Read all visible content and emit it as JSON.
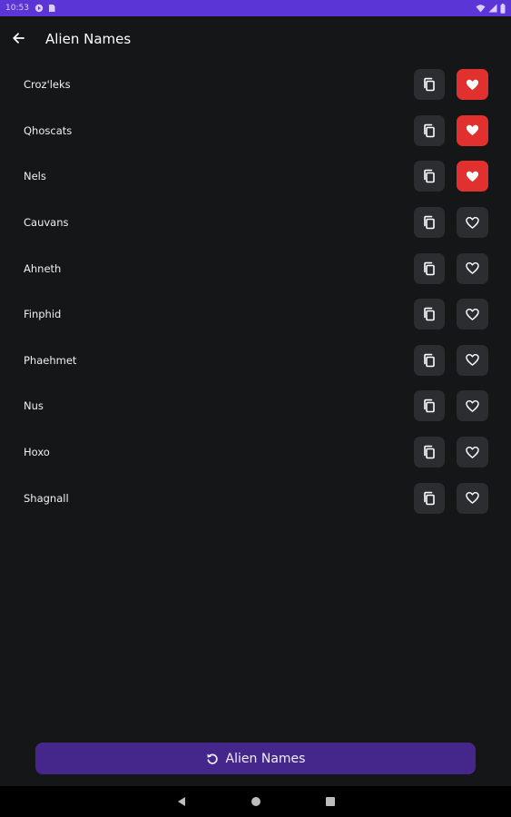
{
  "status_bar": {
    "time": "10:53",
    "left_icons": [
      "play-protect-icon",
      "sim-card-icon"
    ],
    "right_icons": [
      "wifi-icon",
      "signal-icon",
      "battery-icon"
    ]
  },
  "app_bar": {
    "back_icon": "arrow-back-icon",
    "title": "Alien Names"
  },
  "names": [
    {
      "name": "Croz'leks",
      "favorite": true
    },
    {
      "name": "Qhoscats",
      "favorite": true
    },
    {
      "name": "Nels",
      "favorite": true
    },
    {
      "name": "Cauvans",
      "favorite": false
    },
    {
      "name": "Ahneth",
      "favorite": false
    },
    {
      "name": "Finphid",
      "favorite": false
    },
    {
      "name": "Phaehmet",
      "favorite": false
    },
    {
      "name": "Nus",
      "favorite": false
    },
    {
      "name": "Hoxo",
      "favorite": false
    },
    {
      "name": "Shagnall",
      "favorite": false
    }
  ],
  "generate_button": {
    "icon": "refresh-icon",
    "label": "Alien Names"
  },
  "colors": {
    "accent": "#5b35d5",
    "button": "#45278c",
    "favorite_active": "#e0312f",
    "icon_button_bg": "#2b2d31",
    "background": "#151617"
  }
}
